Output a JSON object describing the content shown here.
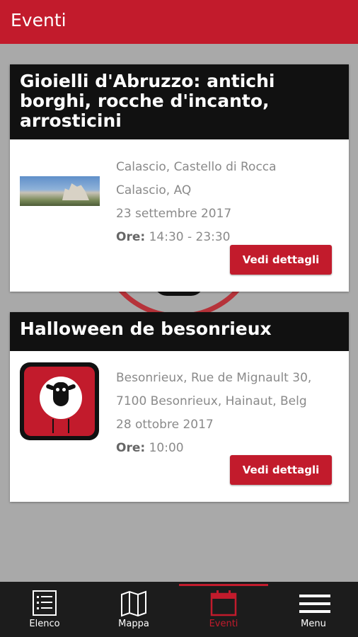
{
  "appbar": {
    "title": "Eventi"
  },
  "events": [
    {
      "title": "Gioielli d'Abruzzo: antichi borghi, rocche d'incanto, arrosticini",
      "place": "Calascio, Castello di Rocca",
      "city": "Calascio, AQ",
      "date": "23 settembre 2017",
      "hours_label": "Ore:",
      "hours": "14:30 - 23:30",
      "button": "Vedi dettagli"
    },
    {
      "title": "Halloween de besonrieux",
      "place": "Besonrieux, Rue de Mignault 30,",
      "city": "7100 Besonrieux, Hainaut, Belg",
      "date": "28 ottobre 2017",
      "hours_label": "Ore:",
      "hours": "10:00",
      "button": "Vedi dettagli"
    }
  ],
  "nav": {
    "items": [
      {
        "label": "Elenco",
        "icon": "list-icon"
      },
      {
        "label": "Mappa",
        "icon": "map-icon"
      },
      {
        "label": "Eventi",
        "icon": "calendar-icon",
        "active": true
      },
      {
        "label": "Menu",
        "icon": "hamburger-menu-icon"
      }
    ]
  },
  "colors": {
    "accent": "#c21b2c",
    "header_bg": "#111111",
    "background": "#a9a9a9"
  }
}
